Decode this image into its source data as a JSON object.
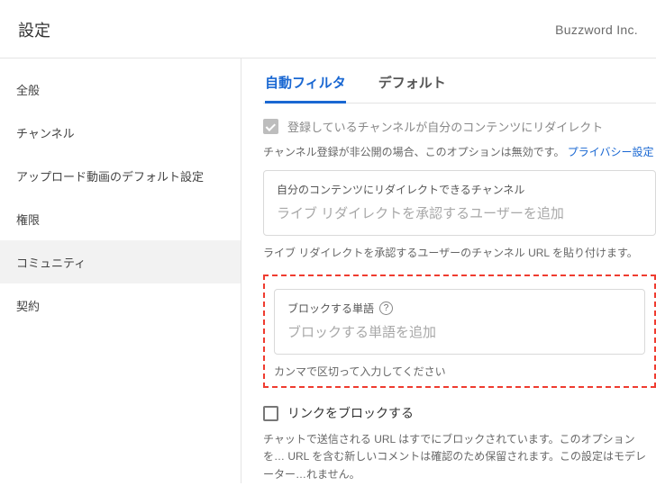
{
  "header": {
    "title": "設定",
    "brand": "Buzzword Inc."
  },
  "sidebar": {
    "items": [
      {
        "label": "全般"
      },
      {
        "label": "チャンネル"
      },
      {
        "label": "アップロード動画のデフォルト設定"
      },
      {
        "label": "権限"
      },
      {
        "label": "コミュニティ",
        "active": true
      },
      {
        "label": "契約"
      }
    ]
  },
  "tabs": [
    {
      "label": "自動フィルタ",
      "active": true
    },
    {
      "label": "デフォルト",
      "active": false
    }
  ],
  "redirect": {
    "checkbox_label": "登録しているチャンネルが自分のコンテンツにリダイレクト",
    "note_prefix": "チャンネル登録が非公開の場合、このオプションは無効です。",
    "note_link": "プライバシー設定",
    "field_label": "自分のコンテンツにリダイレクトできるチャンネル",
    "placeholder": "ライブ リダイレクトを承認するユーザーを追加",
    "help": "ライブ リダイレクトを承認するユーザーのチャンネル URL を貼り付けます。"
  },
  "block_words": {
    "field_label": "ブロックする単語",
    "placeholder": "ブロックする単語を追加",
    "help": "カンマで区切って入力してください"
  },
  "block_links": {
    "checkbox_label": "リンクをブロックする",
    "desc": "チャットで送信される URL はすでにブロックされています。このオプションを… URL を含む新しいコメントは確認のため保留されます。この設定はモデレーター…れません。"
  }
}
